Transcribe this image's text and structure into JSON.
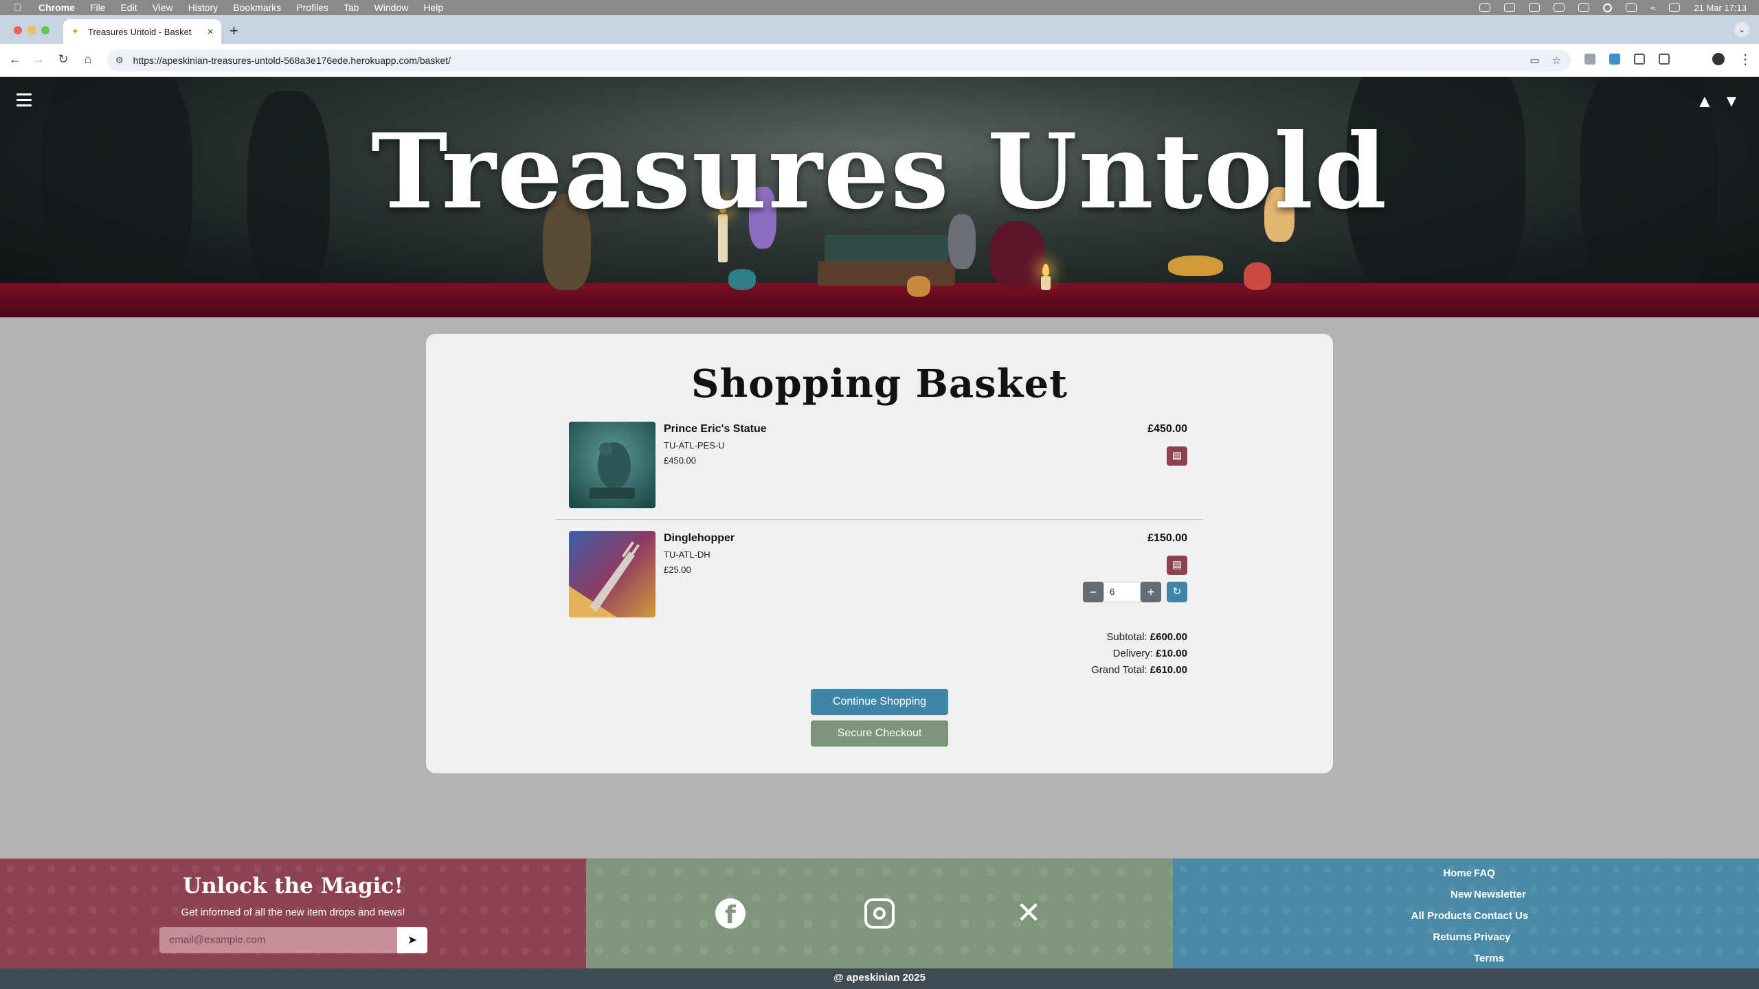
{
  "os_menubar": {
    "app_name": "Chrome",
    "menus": [
      "File",
      "Edit",
      "View",
      "History",
      "Bookmarks",
      "Profiles",
      "Tab",
      "Window",
      "Help"
    ],
    "datetime": "21 Mar  17:13"
  },
  "browser": {
    "tab_title": "Treasures Untold - Basket",
    "url": "https://apeskinian-treasures-untold-568a3e176ede.herokuapp.com/basket/"
  },
  "site": {
    "brand": "Treasures Untold",
    "icons": [
      "menu-icon",
      "wizard-hat-icon",
      "basket-icon"
    ]
  },
  "basket": {
    "title": "Shopping Basket",
    "items": [
      {
        "name": "Prince Eric's Statue",
        "sku": "TU-ATL-PES-U",
        "unit_price": "£450.00",
        "line_total": "£450.00"
      },
      {
        "name": "Dinglehopper",
        "sku": "TU-ATL-DH",
        "unit_price": "£25.00",
        "line_total": "£150.00",
        "quantity": "6"
      }
    ],
    "totals": {
      "subtotal_label": "Subtotal:",
      "subtotal": "£600.00",
      "delivery_label": "Delivery:",
      "delivery": "£10.00",
      "grand_total_label": "Grand Total:",
      "grand_total": "£610.00"
    },
    "continue_label": "Continue Shopping",
    "checkout_label": "Secure Checkout"
  },
  "footer": {
    "newsletter_title": "Unlock the Magic!",
    "newsletter_subtitle": "Get informed of all the new item drops and news!",
    "email_placeholder": "email@example.com",
    "links_left": [
      "Home",
      "New",
      "All Products",
      "Returns"
    ],
    "links_right": [
      "FAQ",
      "Newsletter",
      "Contact Us",
      "Privacy",
      "Terms"
    ],
    "copyright": "@ apeskinian 2025"
  },
  "colors": {
    "accent_blue": "#3f85a7",
    "accent_green": "#7c9478",
    "accent_red": "#8e4150",
    "footer_dark": "#3f4a52"
  }
}
